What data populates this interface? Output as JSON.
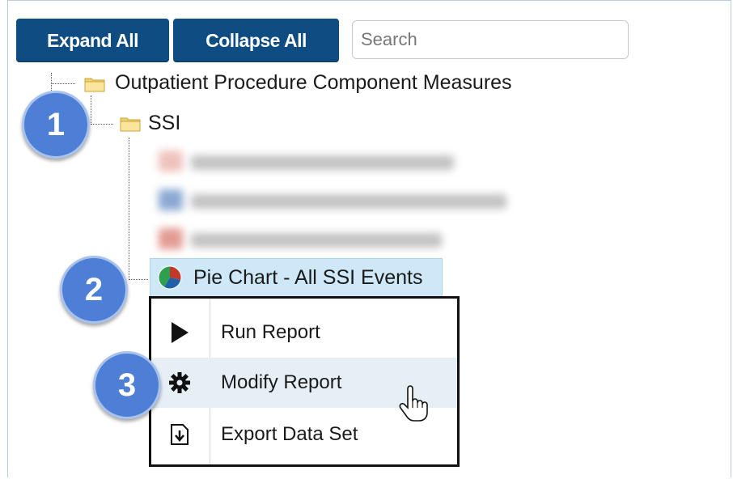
{
  "toolbar": {
    "expand_label": "Expand All",
    "collapse_label": "Collapse All",
    "search_placeholder": "Search"
  },
  "tree": {
    "root_label": "Outpatient Procedure Component Measures",
    "folder_label": "SSI",
    "selected_report": "Pie Chart - All SSI Events"
  },
  "context_menu": {
    "items": [
      {
        "label": "Run Report",
        "icon": "play-icon"
      },
      {
        "label": "Modify Report",
        "icon": "gear-icon"
      },
      {
        "label": "Export Data Set",
        "icon": "export-icon"
      }
    ]
  },
  "callouts": [
    "1",
    "2",
    "3"
  ],
  "colors": {
    "button_bg": "#0f4c81",
    "selection_bg": "#cfe8f7",
    "callout_bg": "#4d7fd6",
    "menu_hover_bg": "#e6eef6"
  }
}
